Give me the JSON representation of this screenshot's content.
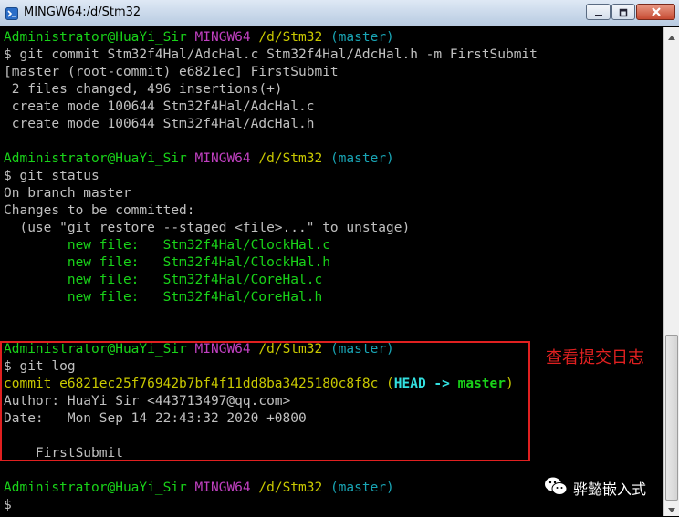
{
  "window": {
    "title": "MINGW64:/d/Stm32"
  },
  "prompt": {
    "user": "Administrator@HuaYi_Sir",
    "env": "MINGW64",
    "path": "/d/Stm32",
    "branch": "(master)"
  },
  "block1": {
    "command": "$ git commit Stm32f4Hal/AdcHal.c Stm32f4Hal/AdcHal.h -m FirstSubmit",
    "output": [
      "[master (root-commit) e6821ec] FirstSubmit",
      " 2 files changed, 496 insertions(+)",
      " create mode 100644 Stm32f4Hal/AdcHal.c",
      " create mode 100644 Stm32f4Hal/AdcHal.h"
    ]
  },
  "block2": {
    "command": "$ git status",
    "output": [
      "On branch master",
      "Changes to be committed:",
      "  (use \"git restore --staged <file>...\" to unstage)"
    ],
    "files": [
      "        new file:   Stm32f4Hal/ClockHal.c",
      "        new file:   Stm32f4Hal/ClockHal.h",
      "        new file:   Stm32f4Hal/CoreHal.c",
      "        new file:   Stm32f4Hal/CoreHal.h"
    ]
  },
  "block3": {
    "command": "$ git log",
    "commit": "commit e6821ec25f76942b7bf4f11dd8ba3425180c8f8c ",
    "ref_open": "(",
    "ref_head": "HEAD -> ",
    "ref_branch": "master",
    "ref_close": ")",
    "author": "Author: HuaYi_Sir <443713497@qq.com>",
    "date": "Date:   Mon Sep 14 22:43:32 2020 +0800",
    "message": "    FirstSubmit"
  },
  "final_prompt": "$",
  "annotation": "查看提交日志",
  "watermark": "骅懿嵌入式",
  "colors": {
    "green": "#19d319",
    "magenta": "#c040c0",
    "yellow": "#c8c800",
    "cyan": "#19a5b5",
    "annotation_red": "#e02020"
  },
  "icons": [
    "mingw-terminal-icon",
    "minimize-icon",
    "maximize-icon",
    "close-icon",
    "scroll-up-icon",
    "scroll-down-icon",
    "wechat-icon"
  ]
}
